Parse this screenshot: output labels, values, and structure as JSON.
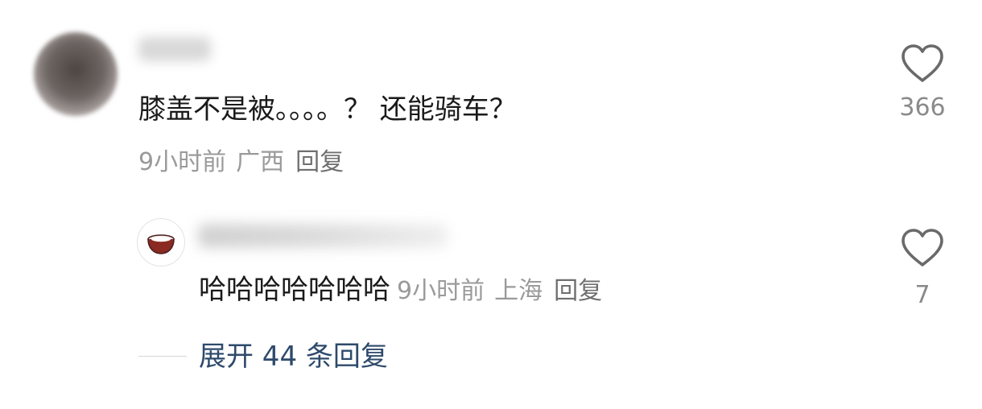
{
  "comment": {
    "text": "膝盖不是被。。。。？ 还能骑车？",
    "time": "9小时前",
    "location": "广西",
    "reply_label": "回复",
    "like_count": "366"
  },
  "reply": {
    "text": "哈哈哈哈哈哈哈",
    "time": "9小时前",
    "location": "上海",
    "reply_label": "回复",
    "like_count": "7"
  },
  "expand": {
    "label": "展开 44 条回复"
  },
  "icons": {
    "like": "heart-outline-icon",
    "reply_avatar": "bowl-icon"
  },
  "colors": {
    "text": "#1a1a1a",
    "meta": "#9a9a9a",
    "link": "#2e4a6b"
  }
}
